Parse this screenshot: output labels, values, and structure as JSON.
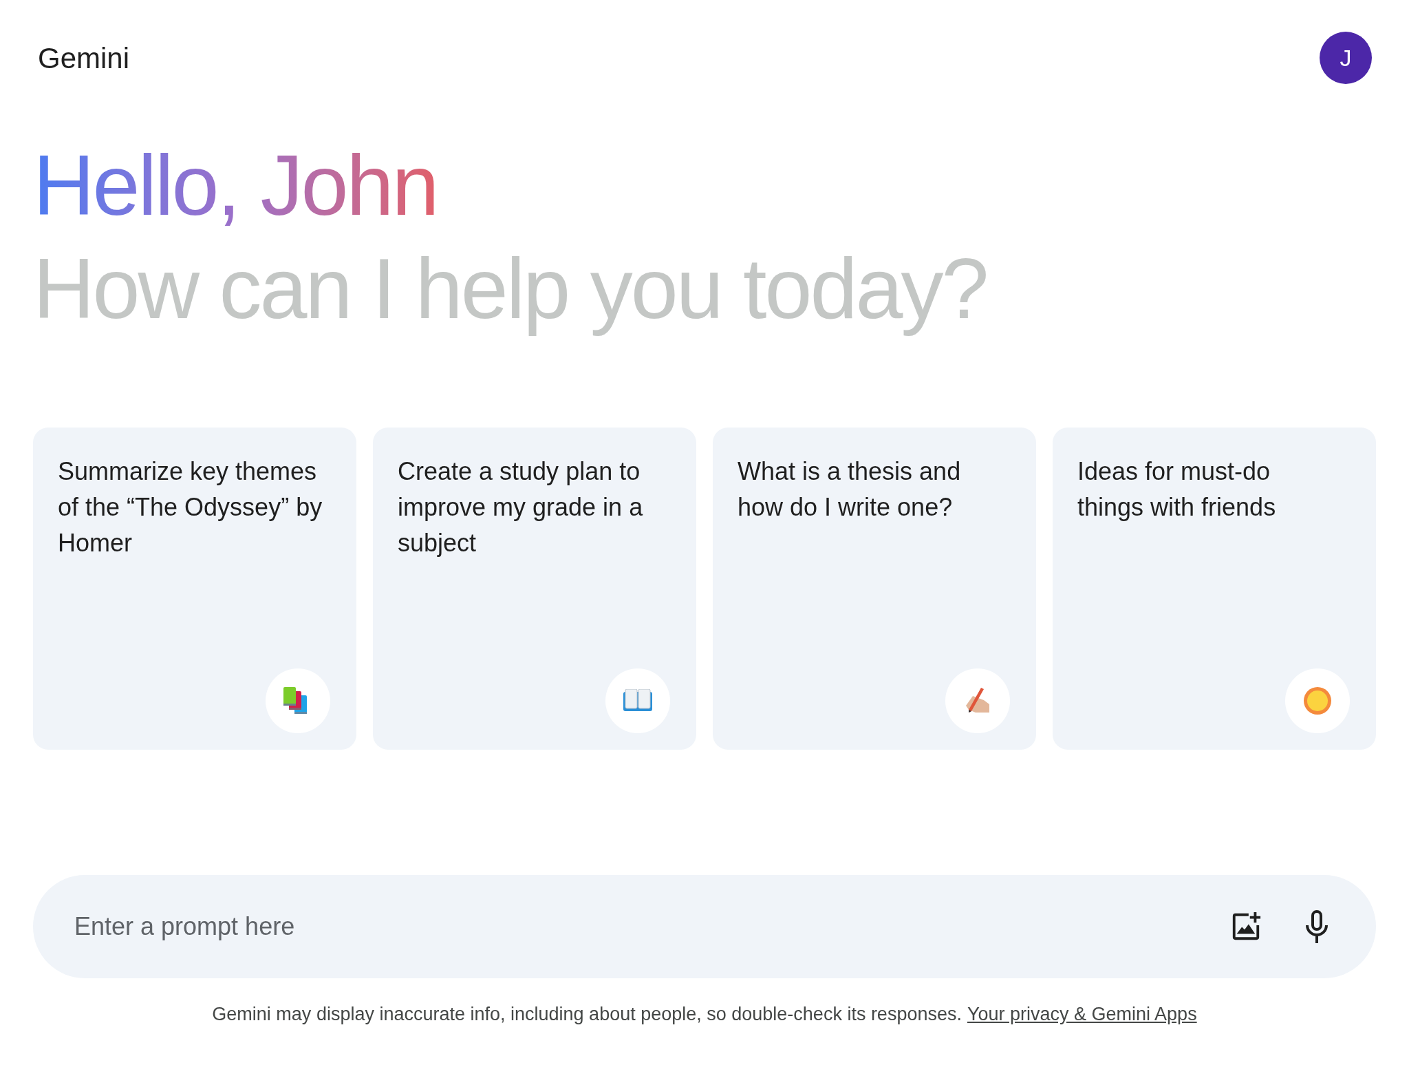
{
  "header": {
    "title": "Gemini",
    "avatar": "J"
  },
  "greeting": {
    "hello": "Hello, John",
    "question": "How can I help you today?"
  },
  "cards": [
    {
      "text": "Summarize key themes of the “The Odyssey” by Homer"
    },
    {
      "text": "Create a study plan to improve my grade in a subject"
    },
    {
      "text": "What is a thesis and how do I write one?"
    },
    {
      "text": "Ideas for must-do things with friends"
    }
  ],
  "prompt": {
    "placeholder": "Enter a prompt here"
  },
  "footer": {
    "notice": "Gemini may display inaccurate info, including about people, so double-check its responses.",
    "link": "Your privacy & Gemini Apps"
  }
}
